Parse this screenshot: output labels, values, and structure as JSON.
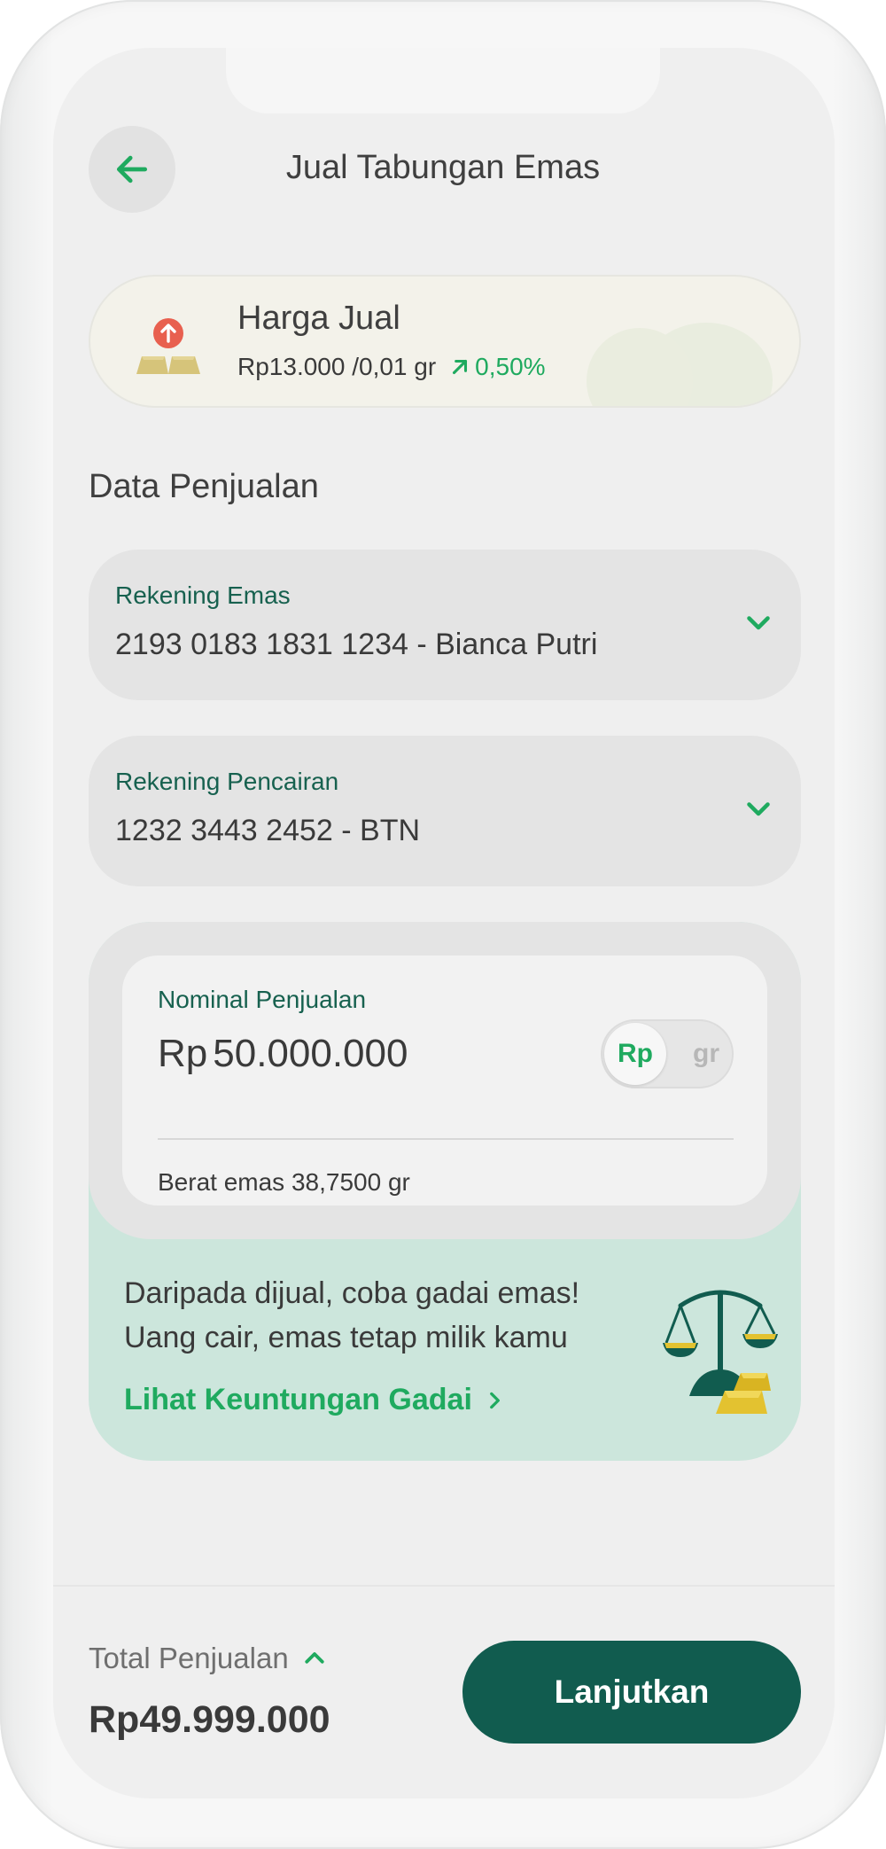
{
  "header": {
    "title": "Jual Tabungan Emas",
    "back_icon": "arrow-left-icon"
  },
  "price_card": {
    "title": "Harga Jual",
    "price": "Rp13.000 /0,01 gr",
    "change": "0,50%",
    "change_icon": "arrow-up-right-icon",
    "icon": "gold-bars-icon"
  },
  "section_title": "Data Penjualan",
  "fields": [
    {
      "label": "Rekening Emas",
      "value": "2193 0183 1831 1234 - Bianca Putri"
    },
    {
      "label": "Rekening Pencairan",
      "value": "1232 3443 2452 - BTN"
    }
  ],
  "nominal": {
    "label": "Nominal Penjualan",
    "currency": "Rp",
    "amount": "50.000.000",
    "toggle_options": [
      "Rp",
      "gr"
    ],
    "toggle_selected": "Rp",
    "weight_text": "Berat emas 38,7500 gr"
  },
  "promo": {
    "line1": "Daripada dijual, coba gadai emas!",
    "line2": "Uang cair, emas tetap milik kamu",
    "link": "Lihat Keuntungan Gadai"
  },
  "footer": {
    "total_label": "Total Penjualan",
    "total_value": "Rp49.999.000",
    "cta": "Lanjutkan"
  },
  "colors": {
    "primary_dark": "#115c4f",
    "accent_green": "#1faa5f",
    "label_green": "#17614f",
    "promo_bg": "#cce6dc",
    "gold": "#d6c47a"
  }
}
